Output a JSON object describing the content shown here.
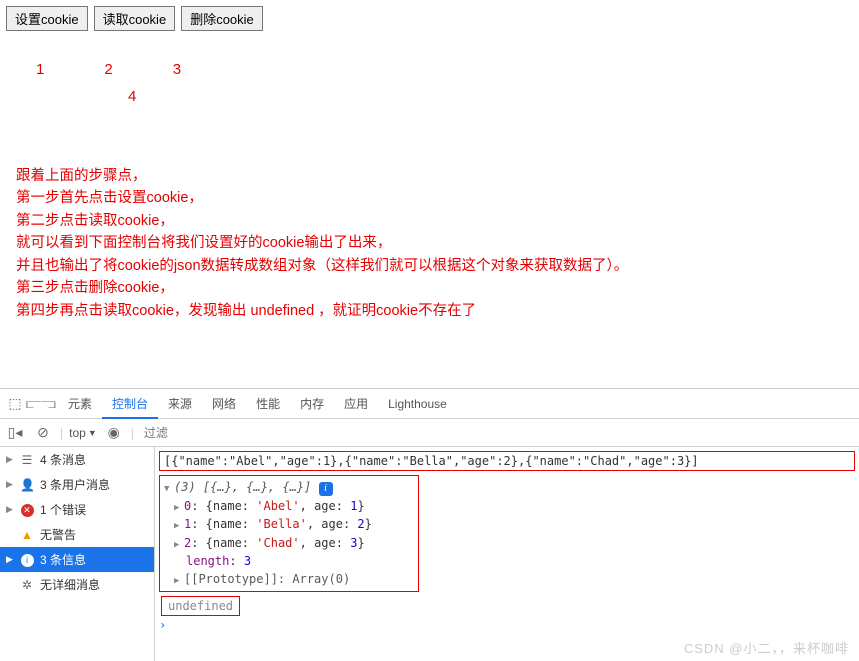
{
  "buttons": {
    "set": "设置cookie",
    "read": "读取cookie",
    "del": "删除cookie"
  },
  "steps": {
    "n1": "1",
    "n2": "2",
    "n3": "3",
    "n4": "4"
  },
  "desc": {
    "l1": "跟着上面的步骤点，",
    "l2": "第一步首先点击设置cookie，",
    "l3": "第二步点击读取cookie，",
    "l4": "就可以看到下面控制台将我们设置好的cookie输出了出来，",
    "l5": "并且也输出了将cookie的json数据转成数组对象（这样我们就可以根据这个对象来获取数据了）。",
    "l6": "第三步点击删除cookie，",
    "l7": "第四步再点击读取cookie，发现输出 undefined ，就证明cookie不存在了"
  },
  "devtabs": {
    "elements": "元素",
    "console": "控制台",
    "sources": "来源",
    "network": "网络",
    "performance": "性能",
    "memory": "内存",
    "application": "应用",
    "lighthouse": "Lighthouse"
  },
  "filter": {
    "context": "top",
    "placeholder": "过滤"
  },
  "sidebar": {
    "msgs": "4 条消息",
    "user": "3 条用户消息",
    "errors": "1 个错误",
    "warns": "无警告",
    "info": "3 条信息",
    "verbose": "无详细消息"
  },
  "console": {
    "raw": "[{\"name\":\"Abel\",\"age\":1},{\"name\":\"Bella\",\"age\":2},{\"name\":\"Chad\",\"age\":3}]",
    "summary": "(3) [{…}, {…}, {…}]",
    "items": [
      {
        "idx": "0",
        "name": "'Abel'",
        "age": "1"
      },
      {
        "idx": "1",
        "name": "'Bella'",
        "age": "2"
      },
      {
        "idx": "2",
        "name": "'Chad'",
        "age": "3"
      }
    ],
    "length_label": "length",
    "length_val": "3",
    "proto": "[[Prototype]]: Array(0)",
    "undefined": "undefined",
    "obj_name_key": "name",
    "obj_age_key": "age"
  },
  "watermark": "CSDN @小二，，来杯咖啡",
  "chart_data": {
    "type": "table",
    "title": "Cookie array contents",
    "columns": [
      "name",
      "age"
    ],
    "rows": [
      [
        "Abel",
        1
      ],
      [
        "Bella",
        2
      ],
      [
        "Chad",
        3
      ]
    ]
  }
}
